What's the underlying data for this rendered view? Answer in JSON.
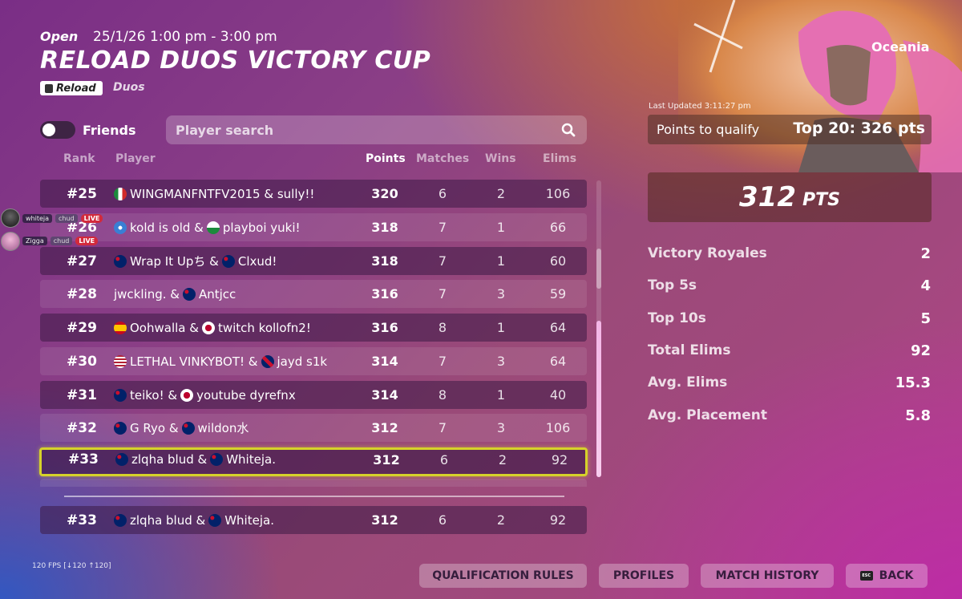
{
  "header": {
    "status": "Open",
    "datetime": "25/1/26 1:00 pm - 3:00 pm",
    "title": "RELOAD DUOS VICTORY CUP",
    "tag": "Reload",
    "mode": "Duos"
  },
  "controls": {
    "friends_label": "Friends",
    "friends_toggle_on": false,
    "search_placeholder": "Player search"
  },
  "table": {
    "columns": [
      "Rank",
      "Player",
      "Points",
      "Matches",
      "Wins",
      "Elims"
    ],
    "rows": [
      {
        "rank": "#25",
        "p1": "WINGMANFNTFV2015 & sully!!",
        "p2": "",
        "f1": "mexico",
        "f2": "",
        "points": "320",
        "matches": "6",
        "wins": "2",
        "elims": "106"
      },
      {
        "rank": "#26",
        "p1": "kold is old &",
        "p2": "playboi yuki!",
        "f1": "scotland",
        "f2": "wales",
        "points": "318",
        "matches": "7",
        "wins": "1",
        "elims": "66"
      },
      {
        "rank": "#27",
        "p1": "Wrap It Upち &",
        "p2": "Clxud!",
        "f1": "australia",
        "f2": "australia",
        "points": "318",
        "matches": "7",
        "wins": "1",
        "elims": "60"
      },
      {
        "rank": "#28",
        "p1": "jwckling. &",
        "p2": "Antjcc",
        "f1": "",
        "f2": "australia",
        "points": "316",
        "matches": "7",
        "wins": "3",
        "elims": "59"
      },
      {
        "rank": "#29",
        "p1": "Oohwalla &",
        "p2": "twitch kollofn2!",
        "f1": "spain",
        "f2": "japan",
        "points": "316",
        "matches": "8",
        "wins": "1",
        "elims": "64"
      },
      {
        "rank": "#30",
        "p1": "LETHAL VINKYBOT! &",
        "p2": "jayd s1k",
        "f1": "usa",
        "f2": "uk",
        "points": "314",
        "matches": "7",
        "wins": "3",
        "elims": "64"
      },
      {
        "rank": "#31",
        "p1": "teiko! &",
        "p2": "youtube dyrefnx",
        "f1": "australia",
        "f2": "japan",
        "points": "314",
        "matches": "8",
        "wins": "1",
        "elims": "40"
      },
      {
        "rank": "#32",
        "p1": "G Ryo &",
        "p2": "wildon水",
        "f1": "australia",
        "f2": "australia",
        "points": "312",
        "matches": "7",
        "wins": "3",
        "elims": "106"
      },
      {
        "rank": "#33",
        "p1": "zlqha blud &",
        "p2": "Whiteja.",
        "f1": "australia",
        "f2": "australia",
        "points": "312",
        "matches": "6",
        "wins": "2",
        "elims": "92"
      }
    ],
    "pinned": {
      "rank": "#33",
      "p1": "zlqha blud &",
      "p2": "Whiteja.",
      "f1": "australia",
      "f2": "australia",
      "points": "312",
      "matches": "6",
      "wins": "2",
      "elims": "92"
    }
  },
  "live_overlay": [
    {
      "name": "whiteja",
      "badge": "chud",
      "live": "LIVE"
    },
    {
      "name": "Zigga",
      "badge": "chud",
      "live": "LIVE"
    }
  ],
  "panel": {
    "region": "Oceania",
    "last_updated": "Last Updated 3:11:27 pm",
    "qualify_label": "Points to qualify",
    "qualify_value": "Top 20: 326 pts",
    "points": "312",
    "points_unit": "PTS",
    "stats": [
      {
        "label": "Victory Royales",
        "value": "2"
      },
      {
        "label": "Top 5s",
        "value": "4"
      },
      {
        "label": "Top 10s",
        "value": "5"
      },
      {
        "label": "Total Elims",
        "value": "92"
      },
      {
        "label": "Avg. Elims",
        "value": "15.3"
      },
      {
        "label": "Avg. Placement",
        "value": "5.8"
      }
    ]
  },
  "footer": {
    "fps": "120 FPS [↓120 ↑120]",
    "buttons": [
      "QUALIFICATION RULES",
      "PROFILES",
      "MATCH HISTORY",
      "BACK"
    ],
    "esc_key": "ESC"
  },
  "colors": {
    "selected_outline": "#d6d22a",
    "live_badge": "#d22a3c"
  }
}
